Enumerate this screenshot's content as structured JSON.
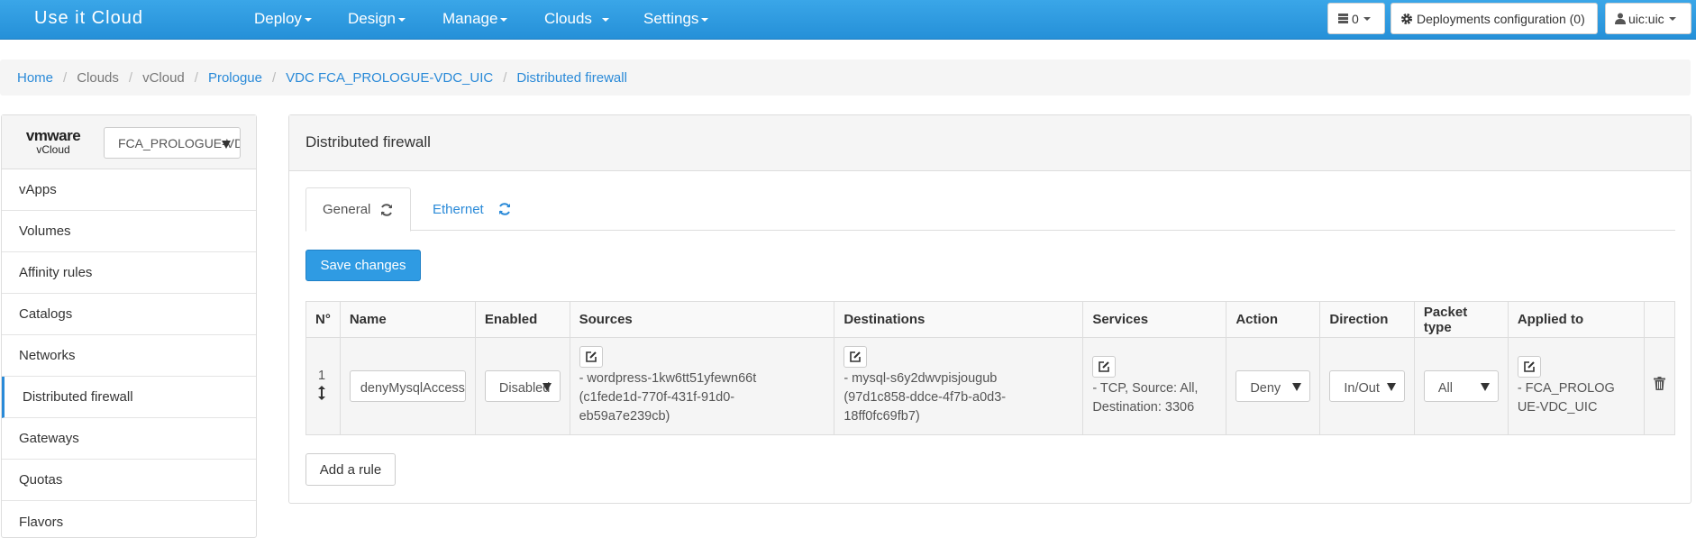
{
  "navbar": {
    "brand": "Use it Cloud",
    "menus": [
      "Deploy",
      "Design",
      "Manage",
      "Clouds",
      "Settings"
    ],
    "servers_count": "0",
    "deployments_config": "Deployments configuration (0)",
    "user": "uic:uic"
  },
  "breadcrumb": [
    "Home",
    "Clouds",
    "vCloud",
    "Prologue",
    "VDC FCA_PROLOGUE-VDC_UIC",
    "Distributed firewall"
  ],
  "sidebar": {
    "logo_text": "vmware",
    "logo_sub": "vCloud",
    "vdc_select": "FCA_PROLOGUE-VDC_UIC",
    "items": [
      "vApps",
      "Volumes",
      "Affinity rules",
      "Catalogs",
      "Networks",
      "Distributed firewall",
      "Gateways",
      "Quotas",
      "Flavors"
    ]
  },
  "main": {
    "title": "Distributed firewall",
    "tabs": [
      "General",
      "Ethernet"
    ],
    "save_label": "Save changes",
    "add_rule_label": "Add a rule",
    "columns": [
      "N°",
      "Name",
      "Enabled",
      "Sources",
      "Destinations",
      "Services",
      "Action",
      "Direction",
      "Packet type",
      "Applied to"
    ],
    "rows": [
      {
        "number": "1",
        "name": "denyMysqlAccess",
        "enabled": "Disabled",
        "sources": "- wordpress-1kw6tt51yfewn66t (c1fede1d-770f-431f-91d0-eb59a7e239cb)",
        "destinations": "- mysql-s6y2dwvpisjougub (97d1c858-ddce-4f7b-a0d3-18ff0fc69fb7)",
        "services": "- TCP, Source: All, Destination: 3306",
        "action": "Deny",
        "direction": "In/Out",
        "packet_type": "All",
        "applied_to": "- FCA_PROLOGUE-VDC_UIC"
      }
    ]
  },
  "colors": {
    "primary": "#2f9be3",
    "link": "#2a8ad8",
    "navbar": "#2590d8"
  }
}
